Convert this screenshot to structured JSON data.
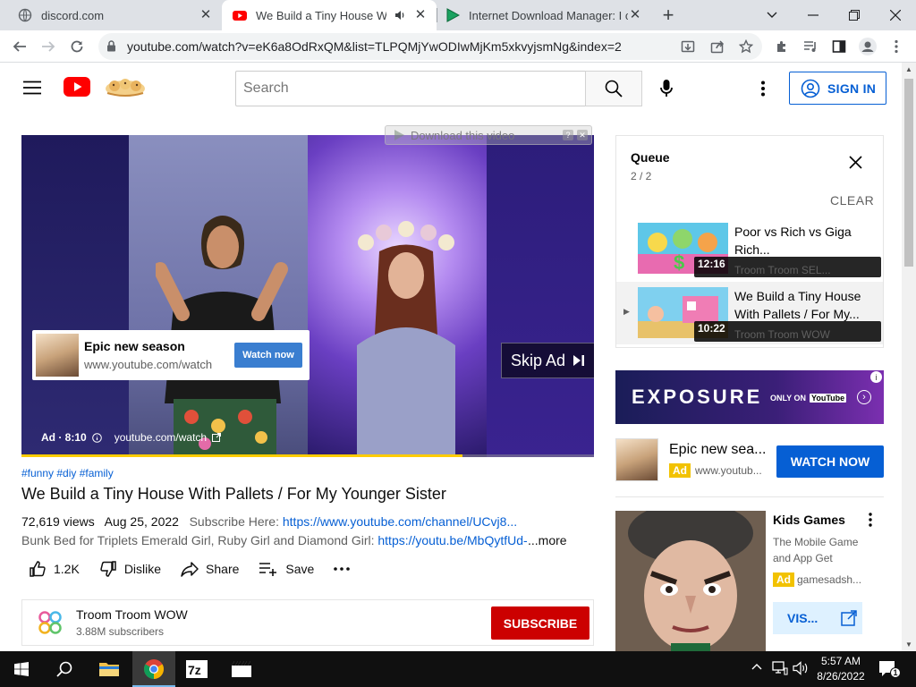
{
  "browser": {
    "tabs": [
      {
        "title": "discord.com",
        "close": "✕"
      },
      {
        "title": "We Build a Tiny House With",
        "close": "✕"
      },
      {
        "title": "Internet Download Manager: I ca",
        "close": "✕"
      }
    ],
    "new_tab": "+",
    "url": "youtube.com/watch?v=eK6a8OdRxQM&list=TLPQMjYwODIwMjKm5xkvyjsmNg&index=2"
  },
  "masthead": {
    "search_placeholder": "Search",
    "sign_in": "SIGN IN"
  },
  "player": {
    "download_overlay": "Download this video",
    "ad_card": {
      "title": "Epic new season",
      "url": "www.youtube.com/watch",
      "button": "Watch now"
    },
    "skip_ad": "Skip Ad",
    "ad_label": "Ad · 8:10",
    "ad_domain": "youtube.com/watch",
    "progress_fraction": 0.77
  },
  "video": {
    "hashtags": "#funny #diy #family",
    "title": "We Build a Tiny House With Pallets / For My Younger Sister",
    "views": "72,619 views",
    "date": "Aug 25, 2022",
    "subscribe_here": "Subscribe Here:",
    "channel_link": "https://www.youtube.com/channel/UCvj8...",
    "desc_prefix": "Bunk Bed for Triplets Emerald Girl, Ruby Girl and Diamond Girl:",
    "desc_link": "https://youtu.be/MbQytfUd-",
    "more": "...more",
    "likes": "1.2K",
    "dislike": "Dislike",
    "share": "Share",
    "save": "Save"
  },
  "channel": {
    "name": "Troom Troom WOW",
    "subscribers": "3.88M subscribers",
    "subscribe": "SUBSCRIBE"
  },
  "queue": {
    "title": "Queue",
    "count": "2 / 2",
    "clear": "CLEAR",
    "items": [
      {
        "title": "Poor vs Rich vs Giga Rich...",
        "channel": "Troom Troom SEL...",
        "duration": "12:16"
      },
      {
        "title": "We Build a Tiny House With Pallets / For My...",
        "channel": "Troom Troom WOW",
        "duration": "10:22"
      }
    ]
  },
  "banner": {
    "word": "EXPOSURE",
    "only_on": "ONLY ON",
    "yt": "YouTube"
  },
  "ad_companion": {
    "title": "Epic new sea...",
    "badge": "Ad",
    "url": "www.youtub...",
    "button": "WATCH NOW"
  },
  "ad_games": {
    "title": "Kids Games",
    "description": "The Mobile Game and App Get",
    "badge": "Ad",
    "url": "gamesadsh...",
    "button": "VIS..."
  },
  "taskbar": {
    "time": "5:57 AM",
    "date": "8/26/2022",
    "notifications": "1"
  }
}
